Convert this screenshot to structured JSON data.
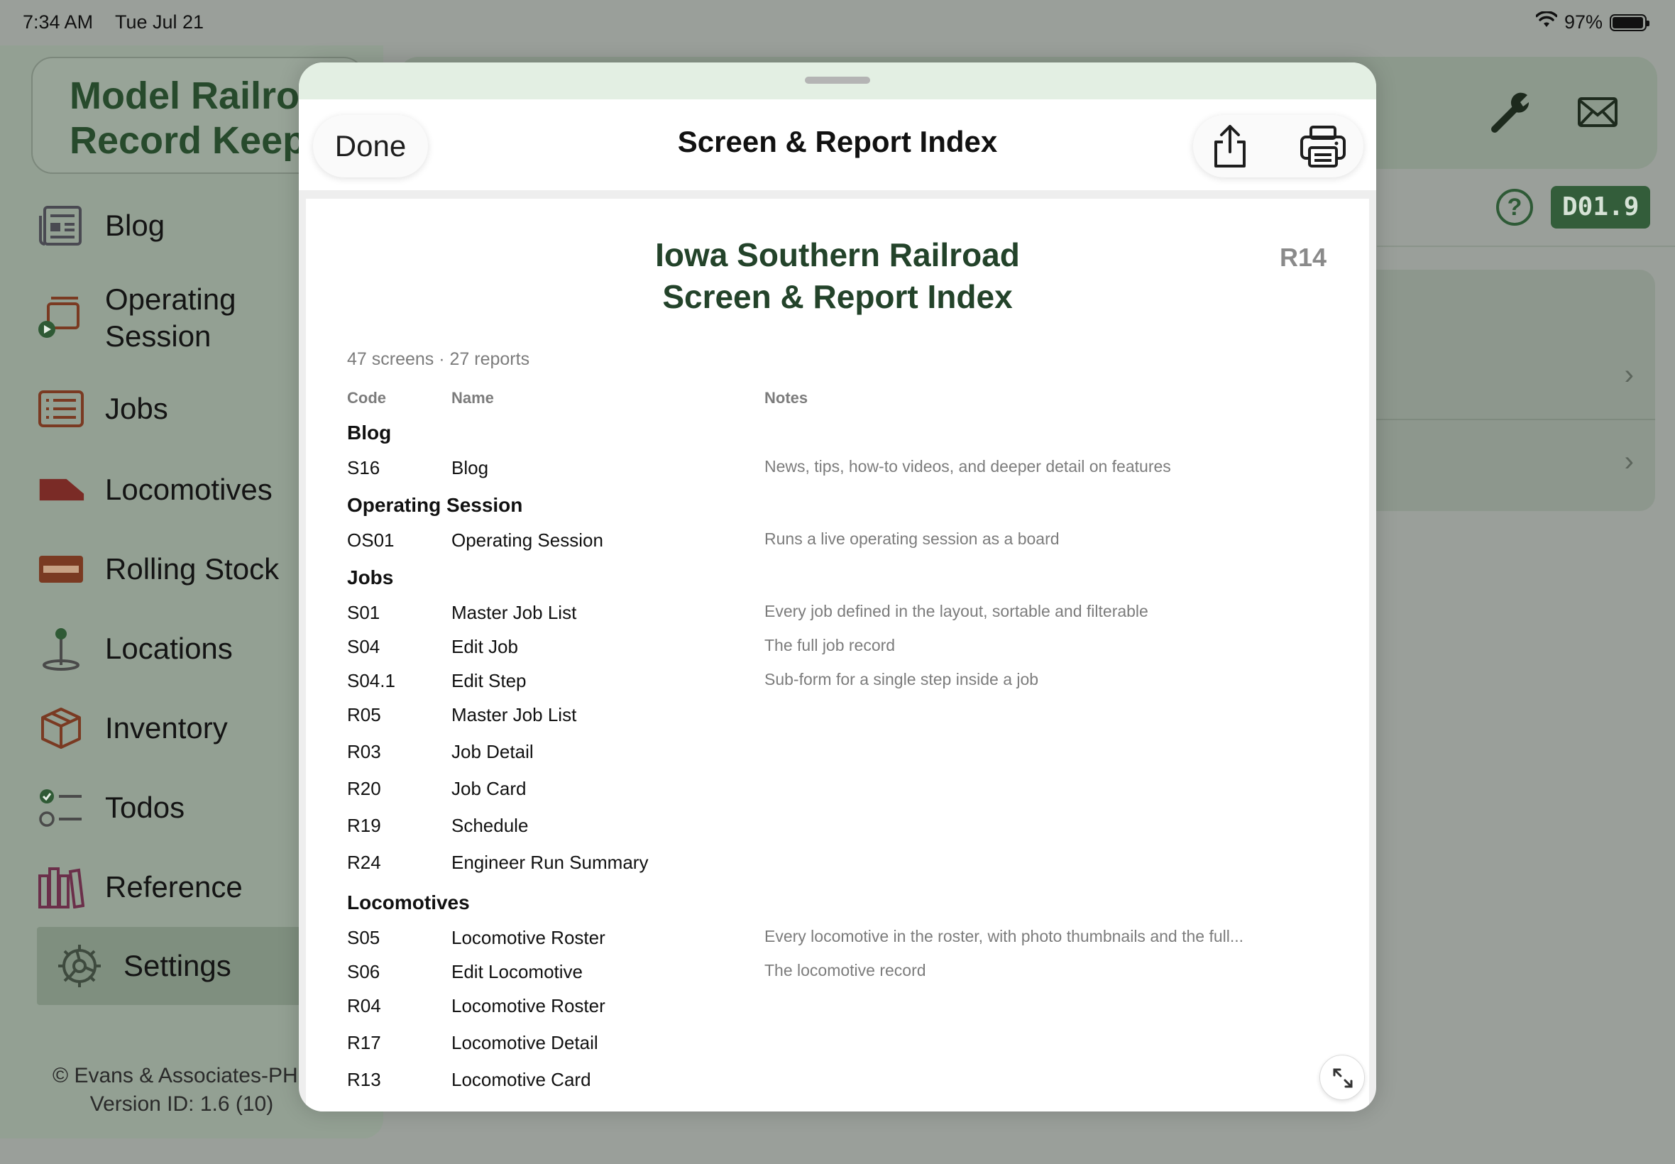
{
  "status_bar": {
    "time": "7:34 AM",
    "date": "Tue Jul 21",
    "battery": "97%",
    "battery_level": 0.97
  },
  "app": {
    "title_line1": "Model Railroad",
    "title_line2": "Record Keeper",
    "footer_copyright": "© Evans & Associates-PHF",
    "footer_version": "Version ID: 1.6 (10)",
    "version_badge": "D01.9",
    "help_label": "?"
  },
  "sidebar": {
    "items": [
      {
        "label": "Blog",
        "icon": "newspaper-icon"
      },
      {
        "label": "Operating\nSession",
        "icon": "operating-session-icon"
      },
      {
        "label": "Jobs",
        "icon": "list-icon"
      },
      {
        "label": "Locomotives",
        "icon": "locomotive-icon"
      },
      {
        "label": "Rolling Stock",
        "icon": "rolling-stock-icon"
      },
      {
        "label": "Locations",
        "icon": "map-pin-icon"
      },
      {
        "label": "Inventory",
        "icon": "box-icon"
      },
      {
        "label": "Todos",
        "icon": "checklist-icon"
      },
      {
        "label": "Reference",
        "icon": "books-icon"
      },
      {
        "label": "Settings",
        "icon": "gear-icon",
        "selected": true
      }
    ]
  },
  "sheet": {
    "done_label": "Done",
    "title": "Screen & Report Index",
    "report": {
      "title_line1": "Iowa Southern Railroad",
      "title_line2": "Screen & Report Index",
      "code": "R14",
      "summary": "47 screens · 27 reports",
      "columns": {
        "code": "Code",
        "name": "Name",
        "notes": "Notes"
      },
      "sections": [
        {
          "title": "Blog",
          "rows": [
            {
              "code": "S16",
              "name": "Blog",
              "notes": "News, tips, how-to videos, and deeper detail on features"
            }
          ]
        },
        {
          "title": "Operating Session",
          "rows": [
            {
              "code": "OS01",
              "name": "Operating Session",
              "notes": "Runs a live operating session as a board"
            }
          ]
        },
        {
          "title": "Jobs",
          "rows": [
            {
              "code": "S01",
              "name": "Master Job List",
              "notes": "Every job defined in the layout, sortable and filterable"
            },
            {
              "code": "S04",
              "name": "Edit Job",
              "notes": "The full job record"
            },
            {
              "code": "S04.1",
              "name": "Edit Step",
              "notes": "Sub-form for a single step inside a job"
            },
            {
              "code": "R05",
              "name": "Master Job List",
              "notes": ""
            },
            {
              "code": "R03",
              "name": "Job Detail",
              "notes": ""
            },
            {
              "code": "R20",
              "name": "Job Card",
              "notes": ""
            },
            {
              "code": "R19",
              "name": "Schedule",
              "notes": ""
            },
            {
              "code": "R24",
              "name": "Engineer Run Summary",
              "notes": ""
            }
          ]
        },
        {
          "title": "Locomotives",
          "rows": [
            {
              "code": "S05",
              "name": "Locomotive Roster",
              "notes": "Every locomotive in the roster, with photo thumbnails and the full..."
            },
            {
              "code": "S06",
              "name": "Edit Locomotive",
              "notes": "The locomotive record"
            },
            {
              "code": "R04",
              "name": "Locomotive Roster",
              "notes": ""
            },
            {
              "code": "R17",
              "name": "Locomotive Detail",
              "notes": ""
            },
            {
              "code": "R13",
              "name": "Locomotive Card",
              "notes": ""
            }
          ]
        }
      ]
    }
  },
  "colors": {
    "accent": "#335d3a",
    "title_green": "#23432a",
    "selected_bg": "#7f8f7f"
  }
}
